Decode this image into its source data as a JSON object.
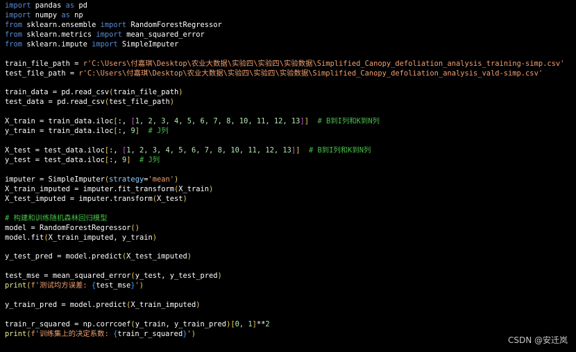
{
  "code_lines": [
    [
      {
        "t": "import",
        "c": "kw"
      },
      {
        "t": " pandas "
      },
      {
        "t": "as",
        "c": "kw"
      },
      {
        "t": " pd"
      }
    ],
    [
      {
        "t": "import",
        "c": "kw"
      },
      {
        "t": " numpy "
      },
      {
        "t": "as",
        "c": "kw"
      },
      {
        "t": " np"
      }
    ],
    [
      {
        "t": "from",
        "c": "kw"
      },
      {
        "t": " sklearn.ensemble "
      },
      {
        "t": "import",
        "c": "kw"
      },
      {
        "t": " RandomForestRegressor"
      }
    ],
    [
      {
        "t": "from",
        "c": "kw"
      },
      {
        "t": " sklearn.metrics "
      },
      {
        "t": "import",
        "c": "kw"
      },
      {
        "t": " mean_squared_error"
      }
    ],
    [
      {
        "t": "from",
        "c": "kw"
      },
      {
        "t": " sklearn.impute "
      },
      {
        "t": "import",
        "c": "kw"
      },
      {
        "t": " SimpleImputer"
      }
    ],
    [],
    [
      {
        "t": "train_file_path = "
      },
      {
        "t": "r'C:\\Users\\付嘉琪\\Desktop\\农业大数据\\实验四\\实验四\\实验数据\\Simplified_Canopy_defoliation_analysis_training-simp.csv'",
        "c": "st"
      }
    ],
    [
      {
        "t": "test_file_path = "
      },
      {
        "t": "r'C:\\Users\\付嘉琪\\Desktop\\农业大数据\\实验四\\实验四\\实验数据\\Simplified_Canopy_defoliation_analysis_vald-simp.csv'",
        "c": "st"
      }
    ],
    [],
    [
      {
        "t": "train_data = pd.read_csv"
      },
      {
        "t": "(",
        "c": "br1"
      },
      {
        "t": "train_file_path"
      },
      {
        "t": ")",
        "c": "br1"
      }
    ],
    [
      {
        "t": "test_data = pd.read_csv"
      },
      {
        "t": "(",
        "c": "br1"
      },
      {
        "t": "test_file_path"
      },
      {
        "t": ")",
        "c": "br1"
      }
    ],
    [],
    [
      {
        "t": "X_train = train_data.iloc"
      },
      {
        "t": "[",
        "c": "br1"
      },
      {
        "t": ":, "
      },
      {
        "t": "[",
        "c": "br2"
      },
      {
        "t": "1, 2, 3, 4, 5, 6, 7, 8, 10, 11, 12, 13",
        "c": "nm"
      },
      {
        "t": "]",
        "c": "br2"
      },
      {
        "t": "]",
        "c": "br1"
      },
      {
        "t": "  # B到I列和K到N列",
        "c": "cm"
      }
    ],
    [
      {
        "t": "y_train = train_data.iloc"
      },
      {
        "t": "[",
        "c": "br1"
      },
      {
        "t": ":, "
      },
      {
        "t": "9",
        "c": "nm"
      },
      {
        "t": "]",
        "c": "br1"
      },
      {
        "t": "  # J列",
        "c": "cm"
      }
    ],
    [],
    [
      {
        "t": "X_test = test_data.iloc"
      },
      {
        "t": "[",
        "c": "br1"
      },
      {
        "t": ":, "
      },
      {
        "t": "[",
        "c": "br2"
      },
      {
        "t": "1, 2, 3, 4, 5, 6, 7, 8, 10, 11, 12, 13",
        "c": "nm"
      },
      {
        "t": "]",
        "c": "br2"
      },
      {
        "t": "]",
        "c": "br1"
      },
      {
        "t": "  # B到I列和K到N列",
        "c": "cm"
      }
    ],
    [
      {
        "t": "y_test = test_data.iloc"
      },
      {
        "t": "[",
        "c": "br1"
      },
      {
        "t": ":, "
      },
      {
        "t": "9",
        "c": "nm"
      },
      {
        "t": "]",
        "c": "br1"
      },
      {
        "t": "  # J列",
        "c": "cm"
      }
    ],
    [],
    [
      {
        "t": "imputer = SimpleImputer"
      },
      {
        "t": "(",
        "c": "br1"
      },
      {
        "t": "strategy",
        "c": "kwarg"
      },
      {
        "t": "="
      },
      {
        "t": "'mean'",
        "c": "st"
      },
      {
        "t": ")",
        "c": "br1"
      }
    ],
    [
      {
        "t": "X_train_imputed = imputer.fit_transform"
      },
      {
        "t": "(",
        "c": "br1"
      },
      {
        "t": "X_train"
      },
      {
        "t": ")",
        "c": "br1"
      }
    ],
    [
      {
        "t": "X_test_imputed = imputer.transform"
      },
      {
        "t": "(",
        "c": "br1"
      },
      {
        "t": "X_test"
      },
      {
        "t": ")",
        "c": "br1"
      }
    ],
    [],
    [
      {
        "t": "# 构建和训练随机森林回归模型",
        "c": "cm"
      }
    ],
    [
      {
        "t": "model = RandomForestRegressor"
      },
      {
        "t": "(",
        "c": "br1"
      },
      {
        "t": ")",
        "c": "br1"
      }
    ],
    [
      {
        "t": "model.fit"
      },
      {
        "t": "(",
        "c": "br1"
      },
      {
        "t": "X_train_imputed, y_train"
      },
      {
        "t": ")",
        "c": "br1"
      }
    ],
    [],
    [
      {
        "t": "y_test_pred = model.predict"
      },
      {
        "t": "(",
        "c": "br1"
      },
      {
        "t": "X_test_imputed"
      },
      {
        "t": ")",
        "c": "br1"
      }
    ],
    [],
    [
      {
        "t": "test_mse = mean_squared_error"
      },
      {
        "t": "(",
        "c": "br1"
      },
      {
        "t": "y_test, y_test_pred"
      },
      {
        "t": ")",
        "c": "br1"
      }
    ],
    [
      {
        "t": "print",
        "c": "fn"
      },
      {
        "t": "(",
        "c": "br1"
      },
      {
        "t": "f'测试均方误差: ",
        "c": "st"
      },
      {
        "t": "{",
        "c": "br3"
      },
      {
        "t": "test_mse"
      },
      {
        "t": "}",
        "c": "br3"
      },
      {
        "t": "'",
        "c": "st"
      },
      {
        "t": ")",
        "c": "br1"
      }
    ],
    [],
    [
      {
        "t": "y_train_pred = model.predict"
      },
      {
        "t": "(",
        "c": "br1"
      },
      {
        "t": "X_train_imputed"
      },
      {
        "t": ")",
        "c": "br1"
      }
    ],
    [],
    [
      {
        "t": "train_r_squared = np.corrcoef"
      },
      {
        "t": "(",
        "c": "br1"
      },
      {
        "t": "y_train, y_train_pred"
      },
      {
        "t": ")",
        "c": "br1"
      },
      {
        "t": "[",
        "c": "br1"
      },
      {
        "t": "0, 1",
        "c": "nm"
      },
      {
        "t": "]",
        "c": "br1"
      },
      {
        "t": "**"
      },
      {
        "t": "2",
        "c": "nm"
      }
    ],
    [
      {
        "t": "print",
        "c": "fn"
      },
      {
        "t": "(",
        "c": "br1"
      },
      {
        "t": "f'训练集上的决定系数: ",
        "c": "st"
      },
      {
        "t": "{",
        "c": "br3"
      },
      {
        "t": "train_r_squared"
      },
      {
        "t": "}",
        "c": "br3"
      },
      {
        "t": "'",
        "c": "st"
      },
      {
        "t": ")",
        "c": "br1"
      }
    ]
  ],
  "watermark": "CSDN @安迁岚"
}
